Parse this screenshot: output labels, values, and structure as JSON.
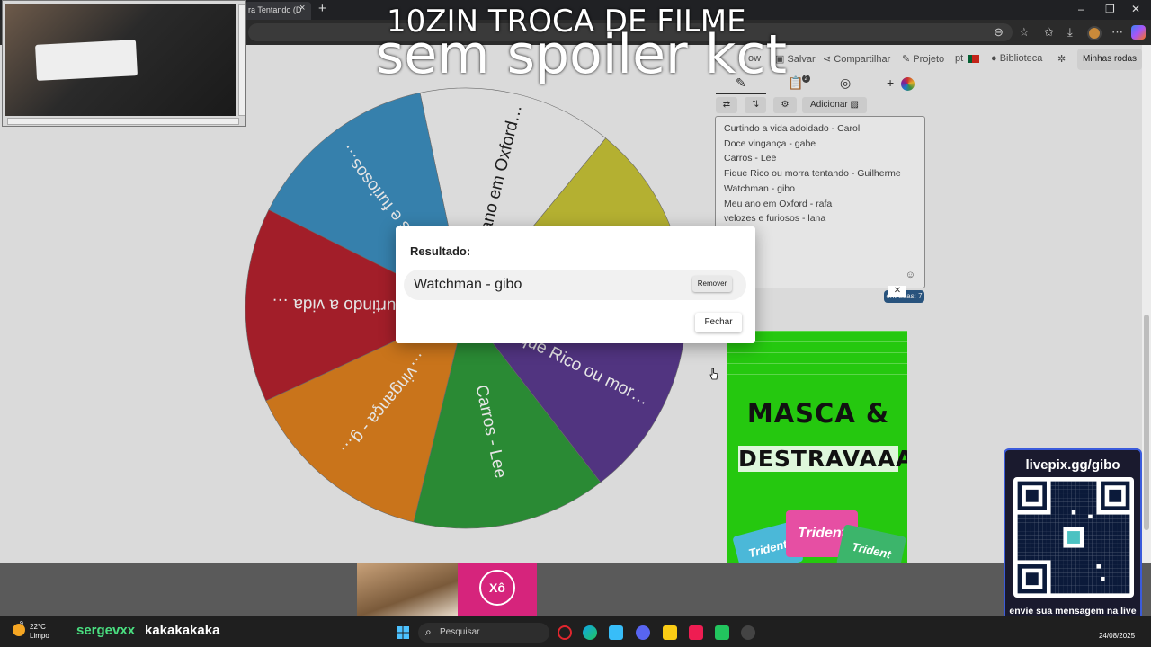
{
  "browser": {
    "tab_title": "ra Tentando (D",
    "tab_close": "×",
    "new_tab": "+",
    "window_controls": [
      "–",
      "❐",
      "✕"
    ]
  },
  "site_nav": {
    "save": "Salvar",
    "share": "Compartilhar",
    "project": "Projeto",
    "library": "Biblioteca",
    "my_wheels": "Minhas rodas",
    "partial_left": "ow"
  },
  "wheel": {
    "segments": [
      {
        "label": "Meu ano em Oxford…",
        "color": "#f4f4f4"
      },
      {
        "label": "Watchman - gibo",
        "color": "#c9c437"
      },
      {
        "label": "Fique Rico ou mor…",
        "color": "#5b3a8f"
      },
      {
        "label": "Carros - Lee",
        "color": "#2f9a3a"
      },
      {
        "label": "…vingança - g…",
        "color": "#e0821f"
      },
      {
        "label": "Curtindo a vida …",
        "color": "#b5222e"
      },
      {
        "label": "velozes e furiosos…",
        "color": "#3d8fc0"
      }
    ]
  },
  "editor": {
    "add_label": "Adicionar",
    "entries": [
      "Curtindo a vida adoidado - Carol",
      "Doce vingança - gabe",
      "Carros - Lee",
      "Fique Rico ou morra tentando - Guilherme",
      "Watchman - gibo",
      "Meu ano em Oxford - rafa",
      "velozes e furiosos - lana"
    ],
    "badge": "2",
    "count_label": "entradas: 7"
  },
  "modal": {
    "title": "Resultado:",
    "winner": "Watchman - gibo",
    "remove_label": "Remover",
    "close_label": "Fechar"
  },
  "ad": {
    "headline_1": "MASCA &",
    "headline_2": "DESTRAVAAA",
    "brand": "Trident",
    "close": "✕",
    "bottom_brand": "Xô"
  },
  "stream": {
    "title_1": "10ZIN TROCA DE FILME",
    "title_2": "sem spoiler kct",
    "pix_title": "livepix.gg/gibo",
    "pix_footer": "envie sua mensagem na live via pix!",
    "chat_user": "sergevxx",
    "chat_message": "kakakakaka"
  },
  "taskbar": {
    "temperature": "22°C",
    "weather": "Limpo",
    "weather_badge": "9",
    "search_placeholder": "Pesquisar",
    "date": "24/08/2025"
  },
  "colors": {
    "accent": "#2d5d8c",
    "pix_border": "#3b5bdb",
    "chat_user": "#4ade80",
    "ad_green": "#25c80f"
  }
}
